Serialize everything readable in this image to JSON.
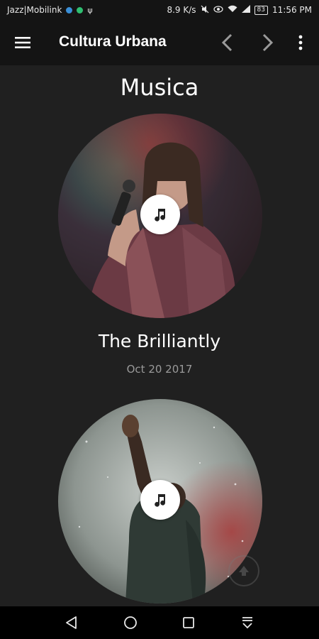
{
  "status_bar": {
    "carrier": "Jazz|Mobilink",
    "speed": "8.9 K/s",
    "battery": "83",
    "time": "11:56 PM"
  },
  "app_bar": {
    "title": "Cultura Urbana",
    "menu_icon": "hamburger-menu-icon",
    "back_icon": "chevron-left-icon",
    "forward_icon": "chevron-right-icon",
    "more_icon": "more-vert-icon"
  },
  "section": {
    "title": "Musica"
  },
  "items": [
    {
      "title": "The Brilliantly",
      "date": "Oct 20 2017",
      "icon": "music-note-icon"
    },
    {
      "title": "",
      "date": "",
      "icon": "music-note-icon"
    }
  ],
  "nav_bar": {
    "back_icon": "triangle-back-icon",
    "home_icon": "circle-home-icon",
    "recents_icon": "square-recents-icon",
    "notifications_icon": "pull-down-icon"
  }
}
